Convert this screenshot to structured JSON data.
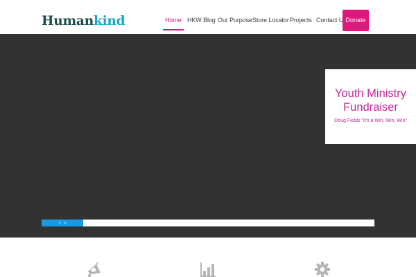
{
  "brand": {
    "logo_part1": "Human",
    "logo_part2": "kind"
  },
  "nav": {
    "items": [
      {
        "label": "Home",
        "active": true
      },
      {
        "label": "HKW Blog",
        "active": false
      },
      {
        "label": "Our Purpose",
        "active": false
      },
      {
        "label": "Store Locator",
        "active": false
      },
      {
        "label": "Projects",
        "active": false
      },
      {
        "label": "Contact Us",
        "active": false
      }
    ],
    "donate_label": "Donate"
  },
  "hero": {
    "caption_title": "Youth Ministry Fundraiser",
    "caption_subtitle": "Doug Fields \"It's a Win, Win, Win\"",
    "prev_arrow": "‹",
    "next_arrow": "›",
    "progress_fraction": 0.125
  },
  "features": {
    "icons": [
      "megaphone-icon",
      "bar-chart-icon",
      "gear-icon"
    ]
  },
  "colors": {
    "accent": "#e0187d",
    "hero_bg": "#323232",
    "caption_text": "#c5289a",
    "progress": "#1a9ae0",
    "logo_dark": "#1b4d4b",
    "logo_light": "#1aa7c7",
    "icon_gray": "#b5b5b5"
  }
}
